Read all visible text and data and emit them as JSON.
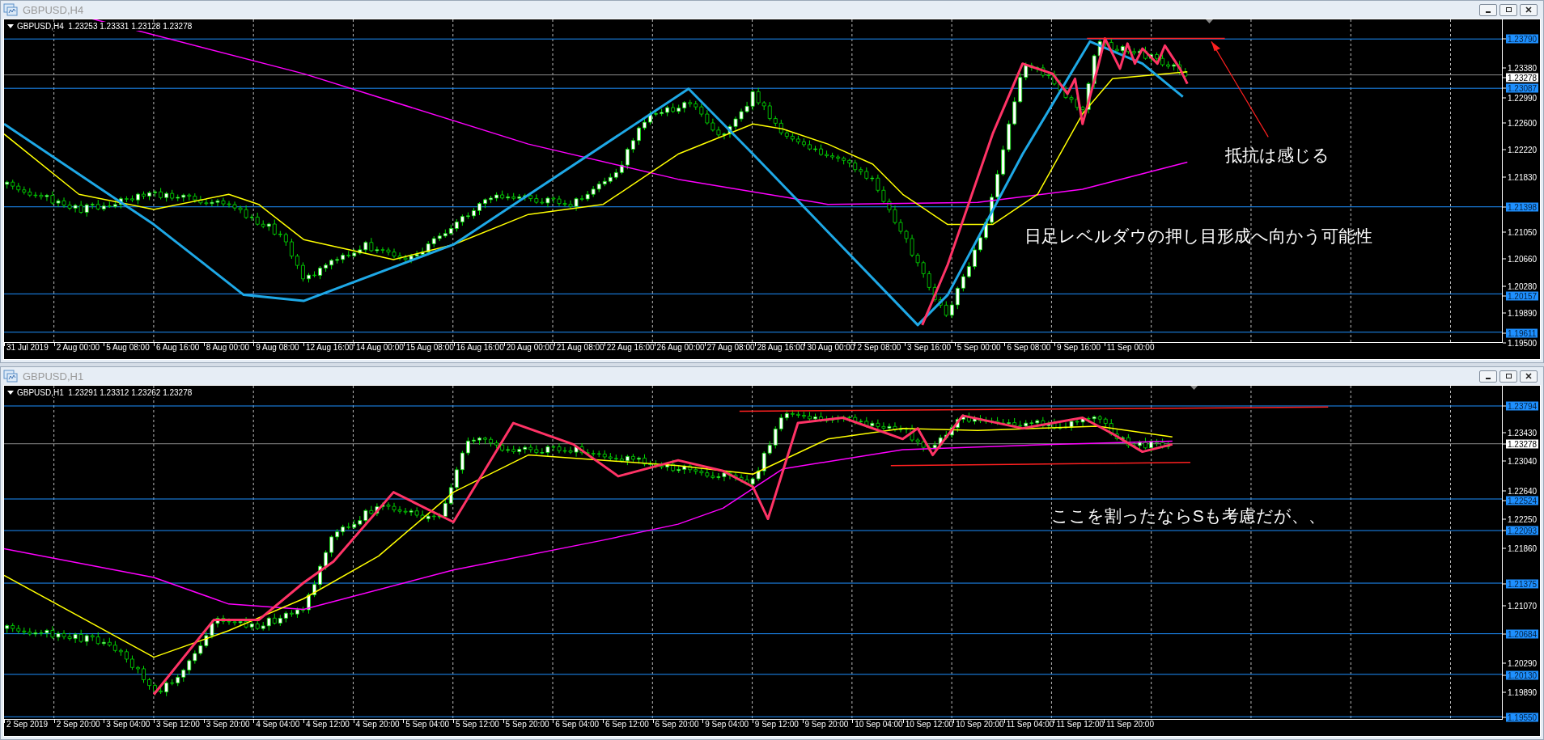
{
  "windows": [
    {
      "title": "GBPUSD,H4",
      "chart": {
        "header": "GBPUSD,H4  1.23253 1.23331 1.23128 1.23278",
        "price_axis": [
          {
            "label": "1.23790",
            "kind": "level"
          },
          {
            "label": "1.23380",
            "kind": "tick"
          },
          {
            "label": "1.23278",
            "kind": "current"
          },
          {
            "label": "1.23087",
            "kind": "level"
          },
          {
            "label": "1.22990",
            "kind": "tick"
          },
          {
            "label": "1.22600",
            "kind": "tick"
          },
          {
            "label": "1.22220",
            "kind": "tick"
          },
          {
            "label": "1.21830",
            "kind": "tick"
          },
          {
            "label": "1.21398",
            "kind": "level"
          },
          {
            "label": "1.21050",
            "kind": "tick"
          },
          {
            "label": "1.20660",
            "kind": "tick"
          },
          {
            "label": "1.20280",
            "kind": "tick"
          },
          {
            "label": "1.20157",
            "kind": "level"
          },
          {
            "label": "1.19890",
            "kind": "tick"
          },
          {
            "label": "1.19611",
            "kind": "level"
          },
          {
            "label": "1.19500",
            "kind": "tick"
          }
        ],
        "time_axis": [
          "31 Jul 2019",
          "2 Aug 00:00",
          "5 Aug 08:00",
          "6 Aug 16:00",
          "8 Aug 00:00",
          "9 Aug 08:00",
          "12 Aug 16:00",
          "14 Aug 00:00",
          "15 Aug 08:00",
          "16 Aug 16:00",
          "20 Aug 00:00",
          "21 Aug 08:00",
          "22 Aug 16:00",
          "26 Aug 00:00",
          "27 Aug 08:00",
          "28 Aug 16:00",
          "30 Aug 00:00",
          "2 Sep 08:00",
          "3 Sep 16:00",
          "5 Sep 00:00",
          "6 Sep 08:00",
          "9 Sep 16:00",
          "11 Sep 00:00"
        ],
        "annotations": [
          "抵抗は感じる",
          "日足レベルダウの押し目形成へ向かう可能性"
        ]
      }
    },
    {
      "title": "GBPUSD,H1",
      "chart": {
        "header": "GBPUSD,H1  1.23291 1.23312 1.23262 1.23278",
        "price_axis": [
          {
            "label": "1.23794",
            "kind": "level"
          },
          {
            "label": "1.23430",
            "kind": "tick"
          },
          {
            "label": "1.23278",
            "kind": "current"
          },
          {
            "label": "1.23040",
            "kind": "tick"
          },
          {
            "label": "1.22640",
            "kind": "tick"
          },
          {
            "label": "1.22524",
            "kind": "level"
          },
          {
            "label": "1.22250",
            "kind": "tick"
          },
          {
            "label": "1.22093",
            "kind": "level"
          },
          {
            "label": "1.21860",
            "kind": "tick"
          },
          {
            "label": "1.21375",
            "kind": "level"
          },
          {
            "label": "1.21070",
            "kind": "tick"
          },
          {
            "label": "1.20684",
            "kind": "level"
          },
          {
            "label": "1.20290",
            "kind": "tick"
          },
          {
            "label": "1.20130",
            "kind": "level"
          },
          {
            "label": "1.19890",
            "kind": "tick"
          },
          {
            "label": "1.19550",
            "kind": "level"
          }
        ],
        "time_axis": [
          "2 Sep 2019",
          "2 Sep 20:00",
          "3 Sep 04:00",
          "3 Sep 12:00",
          "3 Sep 20:00",
          "4 Sep 04:00",
          "4 Sep 12:00",
          "4 Sep 20:00",
          "5 Sep 04:00",
          "5 Sep 12:00",
          "5 Sep 20:00",
          "6 Sep 04:00",
          "6 Sep 12:00",
          "6 Sep 20:00",
          "9 Sep 04:00",
          "9 Sep 12:00",
          "9 Sep 20:00",
          "10 Sep 04:00",
          "10 Sep 12:00",
          "10 Sep 20:00",
          "11 Sep 04:00",
          "11 Sep 12:00",
          "11 Sep 20:00"
        ],
        "annotations": [
          "ここを割ったならSも考慮だが、、"
        ]
      }
    }
  ]
}
